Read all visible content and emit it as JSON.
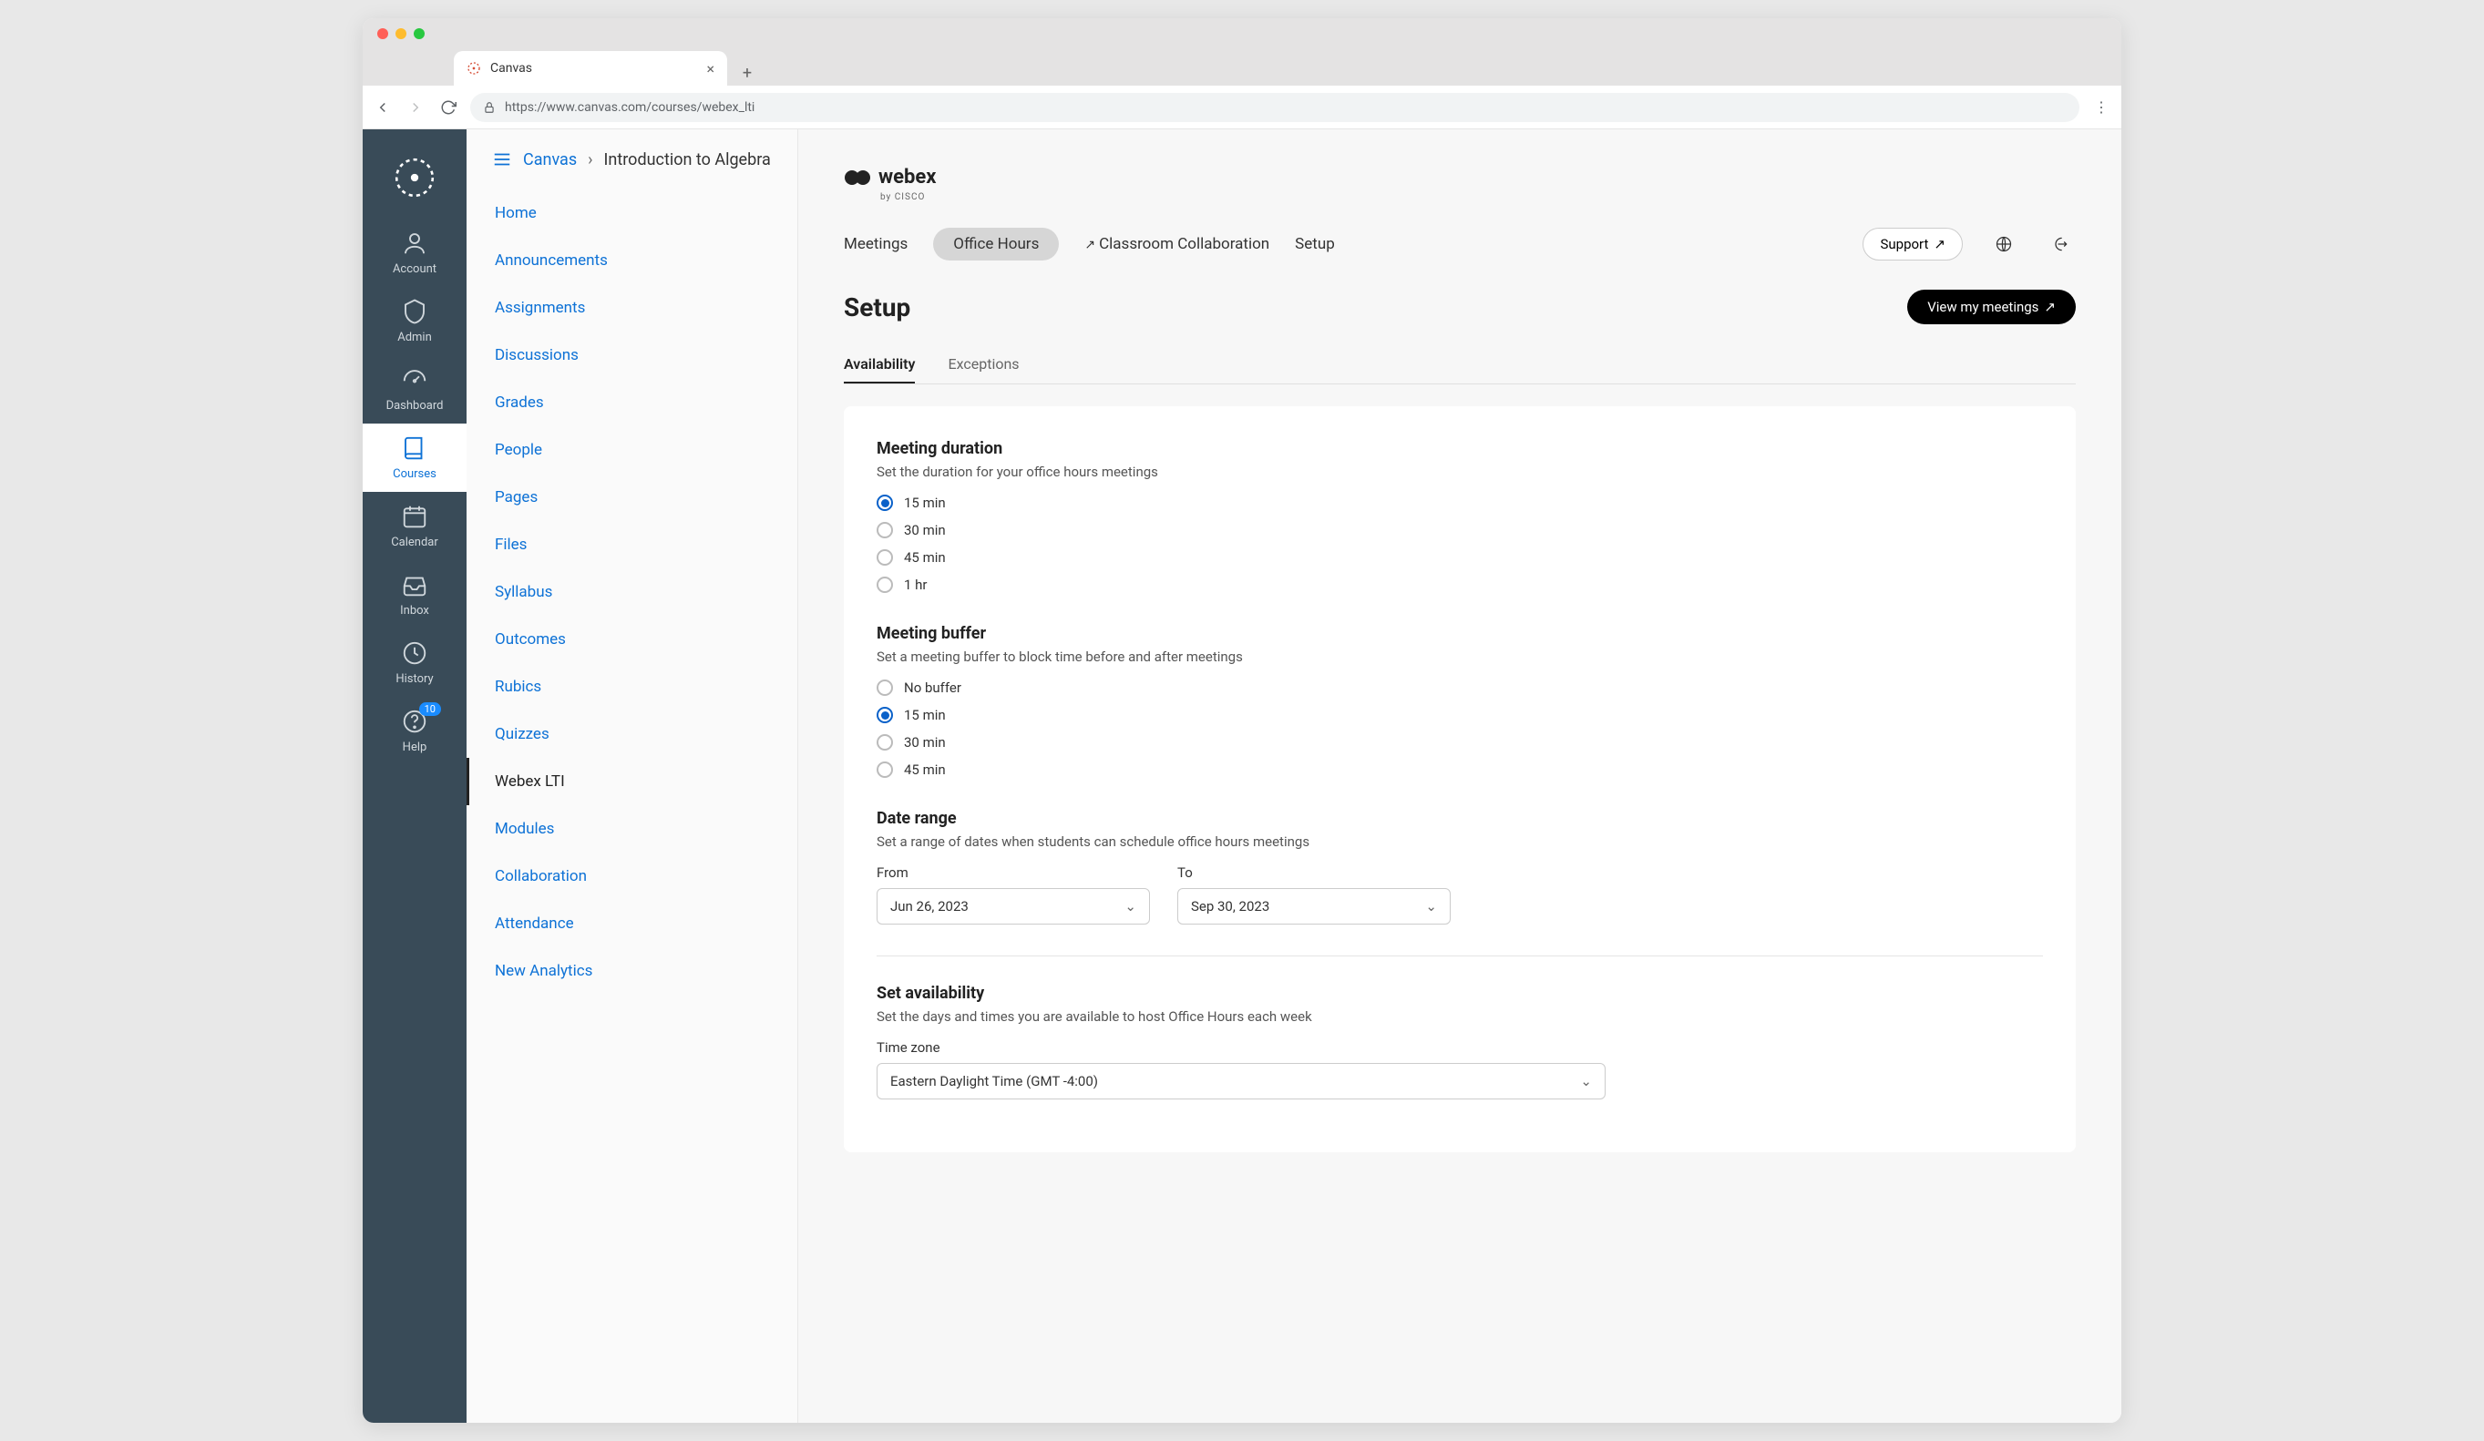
{
  "browser": {
    "tab_title": "Canvas",
    "url": "https://www.canvas.com/courses/webex_lti"
  },
  "breadcrumb": {
    "root": "Canvas",
    "current": "Introduction to Algebra"
  },
  "rail": {
    "items": [
      {
        "label": "Account"
      },
      {
        "label": "Admin"
      },
      {
        "label": "Dashboard"
      },
      {
        "label": "Courses"
      },
      {
        "label": "Calendar"
      },
      {
        "label": "Inbox"
      },
      {
        "label": "History"
      },
      {
        "label": "Help"
      }
    ],
    "help_badge": "10"
  },
  "course_menu": [
    "Home",
    "Announcements",
    "Assignments",
    "Discussions",
    "Grades",
    "People",
    "Pages",
    "Files",
    "Syllabus",
    "Outcomes",
    "Rubics",
    "Quizzes",
    "Webex LTI",
    "Modules",
    "Collaboration",
    "Attendance",
    "New Analytics"
  ],
  "webex": {
    "brand": "webex",
    "brand_sub": "by CISCO",
    "nav": {
      "meetings": "Meetings",
      "office_hours": "Office Hours",
      "classroom": "Classroom Collaboration",
      "setup": "Setup",
      "support": "Support"
    },
    "page_title": "Setup",
    "view_meetings": "View my meetings",
    "subtabs": {
      "availability": "Availability",
      "exceptions": "Exceptions"
    },
    "duration": {
      "title": "Meeting duration",
      "desc": "Set the duration for your office hours meetings",
      "options": [
        "15 min",
        "30 min",
        "45 min",
        "1 hr"
      ],
      "selected": 0
    },
    "buffer": {
      "title": "Meeting buffer",
      "desc": "Set a meeting buffer to block time before and after meetings",
      "options": [
        "No buffer",
        "15 min",
        "30 min",
        "45 min"
      ],
      "selected": 1
    },
    "range": {
      "title": "Date range",
      "desc": "Set a range of dates when students can schedule office hours meetings",
      "from_label": "From",
      "to_label": "To",
      "from": "Jun 26, 2023",
      "to": "Sep 30, 2023"
    },
    "availability": {
      "title": "Set availability",
      "desc": "Set the days and times you are available to host Office Hours each week",
      "tz_label": "Time zone",
      "tz_value": "Eastern Daylight Time (GMT -4:00)"
    }
  }
}
